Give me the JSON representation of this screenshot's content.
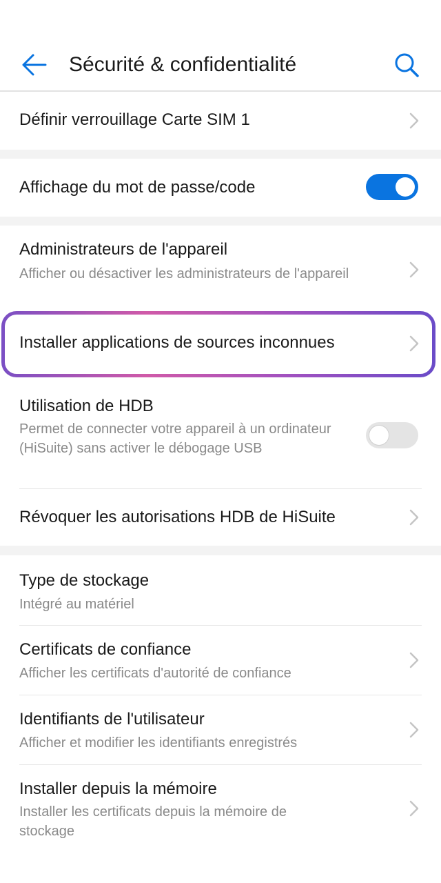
{
  "header": {
    "title": "Sécurité & confidentialité"
  },
  "colors": {
    "accent": "#0a74e0",
    "highlight": "#b45ab8"
  },
  "items": {
    "sim_lock": {
      "label": "Définir verrouillage Carte SIM 1"
    },
    "password_display": {
      "label": "Affichage du mot de passe/code",
      "toggle": "on"
    },
    "device_admins": {
      "label": "Administrateurs de l'appareil",
      "sub": "Afficher ou désactiver les administrateurs de l'appareil"
    },
    "unknown_sources": {
      "label": "Installer applications de sources inconnues"
    },
    "hdb": {
      "label": "Utilisation de HDB",
      "sub": "Permet de connecter votre appareil à un ordinateur (HiSuite) sans activer le débogage USB",
      "toggle": "off"
    },
    "revoke_hdb": {
      "label": "Révoquer les autorisations HDB de HiSuite"
    },
    "storage_type": {
      "label": "Type de stockage",
      "sub": "Intégré au matériel"
    },
    "trusted_certs": {
      "label": "Certificats de confiance",
      "sub": "Afficher les certificats d'autorité de confiance"
    },
    "user_credentials": {
      "label": "Identifiants de l'utilisateur",
      "sub": "Afficher et modifier les identifiants enregistrés"
    },
    "install_from_storage": {
      "label": "Installer depuis la mémoire",
      "sub": "Installer les certificats depuis la mémoire de stockage"
    }
  }
}
